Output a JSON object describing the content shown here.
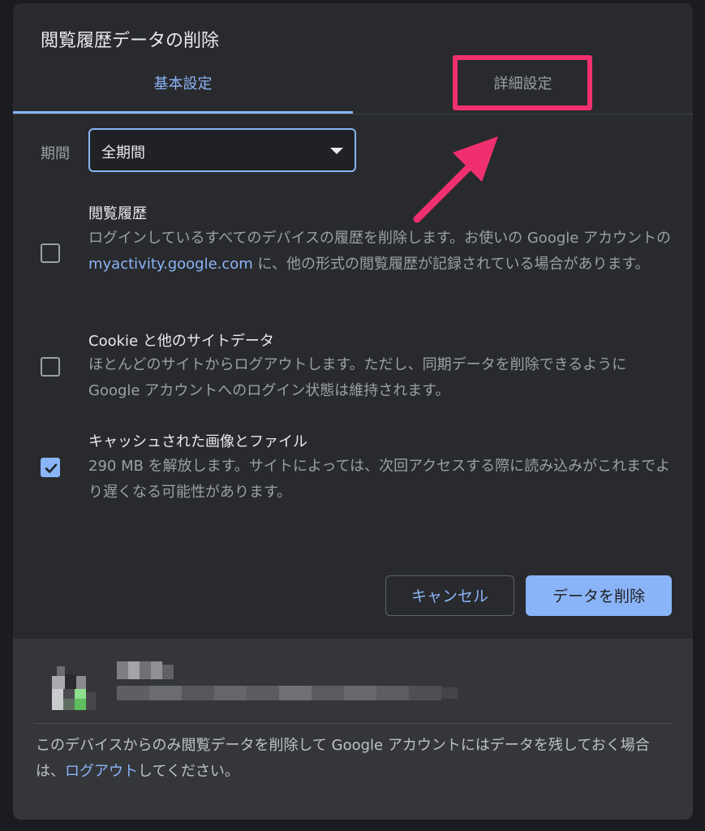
{
  "dialog": {
    "title": "閲覧履歴データの削除"
  },
  "tabs": {
    "basic": "基本設定",
    "advanced": "詳細設定"
  },
  "period": {
    "label": "期間",
    "selected": "全期間"
  },
  "options": [
    {
      "title": "閲覧履歴",
      "desc_before": "ログインしているすべてのデバイスの履歴を削除します。お使いの Google アカウントの ",
      "link": "myactivity.google.com",
      "desc_after": " に、他の形式の閲覧履歴が記録されている場合があります。",
      "checked": false
    },
    {
      "title": "Cookie と他のサイトデータ",
      "desc": "ほとんどのサイトからログアウトします。ただし、同期データを削除できるように Google アカウントへのログイン状態は維持されます。",
      "checked": false
    },
    {
      "title": "キャッシュされた画像とファイル",
      "desc": "290 MB を解放します。サイトによっては、次回アクセスする際に読み込みがこれまでより遅くなる可能性があります。",
      "checked": true
    }
  ],
  "buttons": {
    "cancel": "キャンセル",
    "delete": "データを削除"
  },
  "footer": {
    "text_before": "このデバイスからのみ閲覧データを削除して Google アカウントにはデータを残しておく場合は、",
    "link": "ログアウト",
    "text_after": "してください。"
  },
  "colors": {
    "accent": "#8ab4f8",
    "annotation": "#f0306e",
    "dialog_bg": "#292a2d",
    "footer_bg": "#35363a"
  },
  "icons": {
    "dropdown": "caret-down-icon",
    "checked": "checkmark-icon",
    "annotation": "arrow-icon"
  }
}
